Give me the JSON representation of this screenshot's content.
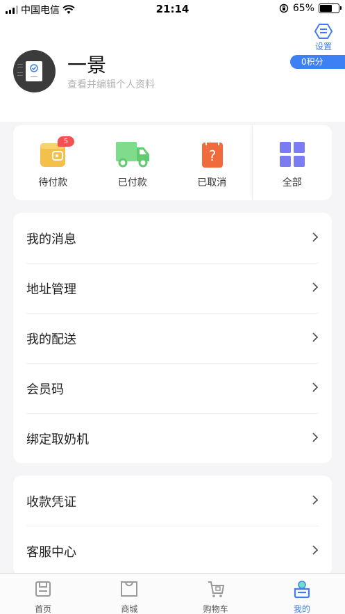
{
  "status_bar": {
    "carrier": "中国电信",
    "time": "21:14",
    "battery": "65%"
  },
  "profile": {
    "name": "一景",
    "subtitle": "查看并编辑个人资料"
  },
  "settings": {
    "label": "设置"
  },
  "points": {
    "label": "0积分"
  },
  "orders": {
    "pending": {
      "label": "待付款",
      "badge": "5"
    },
    "paid": {
      "label": "已付款"
    },
    "cancelled": {
      "label": "已取消"
    },
    "all": {
      "label": "全部"
    }
  },
  "menu": {
    "group1": [
      {
        "label": "我的消息"
      },
      {
        "label": "地址管理"
      },
      {
        "label": "我的配送"
      },
      {
        "label": "会员码"
      },
      {
        "label": "绑定取奶机"
      }
    ],
    "group2": [
      {
        "label": "收款凭证"
      },
      {
        "label": "客服中心"
      }
    ]
  },
  "tabbar": {
    "home": "首页",
    "mall": "商城",
    "cart": "购物车",
    "mine": "我的",
    "active": "mine"
  },
  "colors": {
    "accent": "#3f7ef0",
    "badge": "#f45252",
    "pending_icon": "#f4c04a",
    "paid_icon": "#5fcd6f",
    "cancelled_icon": "#f06a3c",
    "all_icon": "#7b7cf2"
  }
}
